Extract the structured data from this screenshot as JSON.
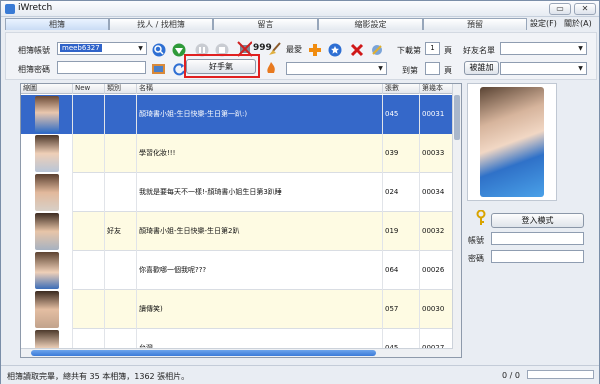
{
  "window": {
    "title": "iWretch",
    "minimize_label": "▭",
    "close_label": "✕"
  },
  "tabs": [
    {
      "label": "相簿",
      "active": true
    },
    {
      "label": "找人 / 找相簿",
      "active": false
    },
    {
      "label": "留言",
      "active": false
    },
    {
      "label": "縮影設定",
      "active": false
    },
    {
      "label": "預留",
      "active": false
    }
  ],
  "menu": {
    "settings": "設定(F)",
    "exit": "關於(A)"
  },
  "toolbar": {
    "account_label": "相簿帳號",
    "account_value": "meeb6327",
    "password_label": "相簿密碼",
    "password_value": "",
    "favorite_label": "最愛",
    "download_label": "下載第",
    "page_value": "1",
    "page_unit": "頁",
    "to_label": "到第",
    "to_value": "",
    "to_unit": "頁",
    "friend_label": "好友名單",
    "friend_value": "",
    "added_by_label": "被誰加",
    "added_by_value": "",
    "favorite_value": "",
    "counter": "999",
    "good_mood_button": "好手氣"
  },
  "grid": {
    "headers": [
      "縮圖",
      "New",
      "類別",
      "名稱",
      "張數",
      "第幾本"
    ],
    "rows": [
      {
        "category": "",
        "title": "顏琦書小姐-生日快樂-生日第一趴:)",
        "count": "045",
        "number": "00031",
        "selected": true,
        "yellow": false
      },
      {
        "category": "",
        "title": "學習化妝!!!",
        "count": "039",
        "number": "00033",
        "selected": false,
        "yellow": true
      },
      {
        "category": "",
        "title": "我就是要每天不一樣!-顏琦書小姐生日第3趴睡",
        "count": "024",
        "number": "00034",
        "selected": false,
        "yellow": false
      },
      {
        "category": "好友",
        "title": "顏琦書小姐-生日快樂-生日第2趴",
        "count": "019",
        "number": "00032",
        "selected": false,
        "yellow": true
      },
      {
        "category": "",
        "title": "你喜歡哪一個我呢???",
        "count": "064",
        "number": "00026",
        "selected": false,
        "yellow": false
      },
      {
        "category": "",
        "title": "讀傳笑)",
        "count": "057",
        "number": "00030",
        "selected": false,
        "yellow": true
      },
      {
        "category": "",
        "title": "台灣",
        "count": "045",
        "number": "00027",
        "selected": false,
        "yellow": false
      }
    ]
  },
  "side": {
    "login_button": "登入模式",
    "account_label": "帳號",
    "password_label": "密碼"
  },
  "status": {
    "message": "相簿讀取完畢，總共有 35 本相簿，1362 張相片。",
    "progress_text": "0 / 0"
  }
}
